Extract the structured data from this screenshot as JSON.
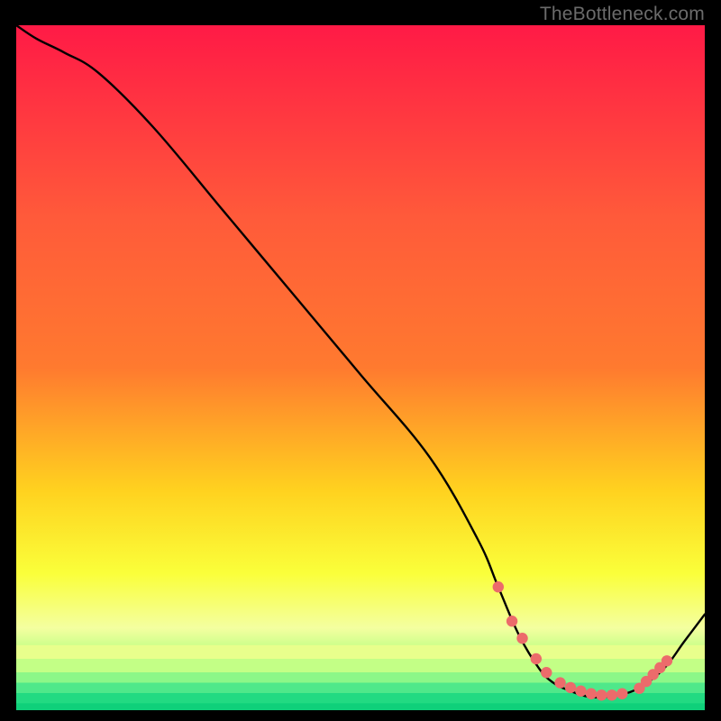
{
  "attribution": "TheBottleneck.com",
  "colors": {
    "top": "#ff1a46",
    "mid1": "#ff7a2f",
    "mid2": "#ffd21f",
    "mid3": "#faff3a",
    "mid4": "#f4ffa0",
    "green1": "#b8ff80",
    "green2": "#5cf08c",
    "green3": "#1ddb82",
    "bottom": "#0fd07a",
    "curve": "#000000",
    "dot": "#ec6b6b"
  },
  "chart_data": {
    "type": "line",
    "title": "",
    "xlabel": "",
    "ylabel": "",
    "xlim": [
      0,
      100
    ],
    "ylim": [
      0,
      100
    ],
    "x": [
      0,
      3,
      7,
      12,
      20,
      30,
      40,
      50,
      60,
      67,
      70,
      73,
      76,
      78,
      80,
      83,
      86,
      90,
      94,
      97,
      100
    ],
    "y": [
      100,
      98,
      96,
      93,
      85,
      73,
      61,
      49,
      37,
      25,
      18,
      11,
      6,
      4,
      3,
      2,
      2,
      3,
      6,
      10,
      14
    ],
    "annotations": {
      "dots_x": [
        70,
        72,
        73.5,
        75.5,
        77,
        79,
        80.5,
        82,
        83.5,
        85,
        86.5,
        88,
        90.5,
        91.5,
        92.5,
        93.5,
        94.5
      ],
      "dots_y": [
        18,
        13,
        10.5,
        7.5,
        5.5,
        4,
        3.3,
        2.8,
        2.4,
        2.2,
        2.2,
        2.4,
        3.2,
        4.2,
        5.2,
        6.2,
        7.2
      ]
    }
  }
}
